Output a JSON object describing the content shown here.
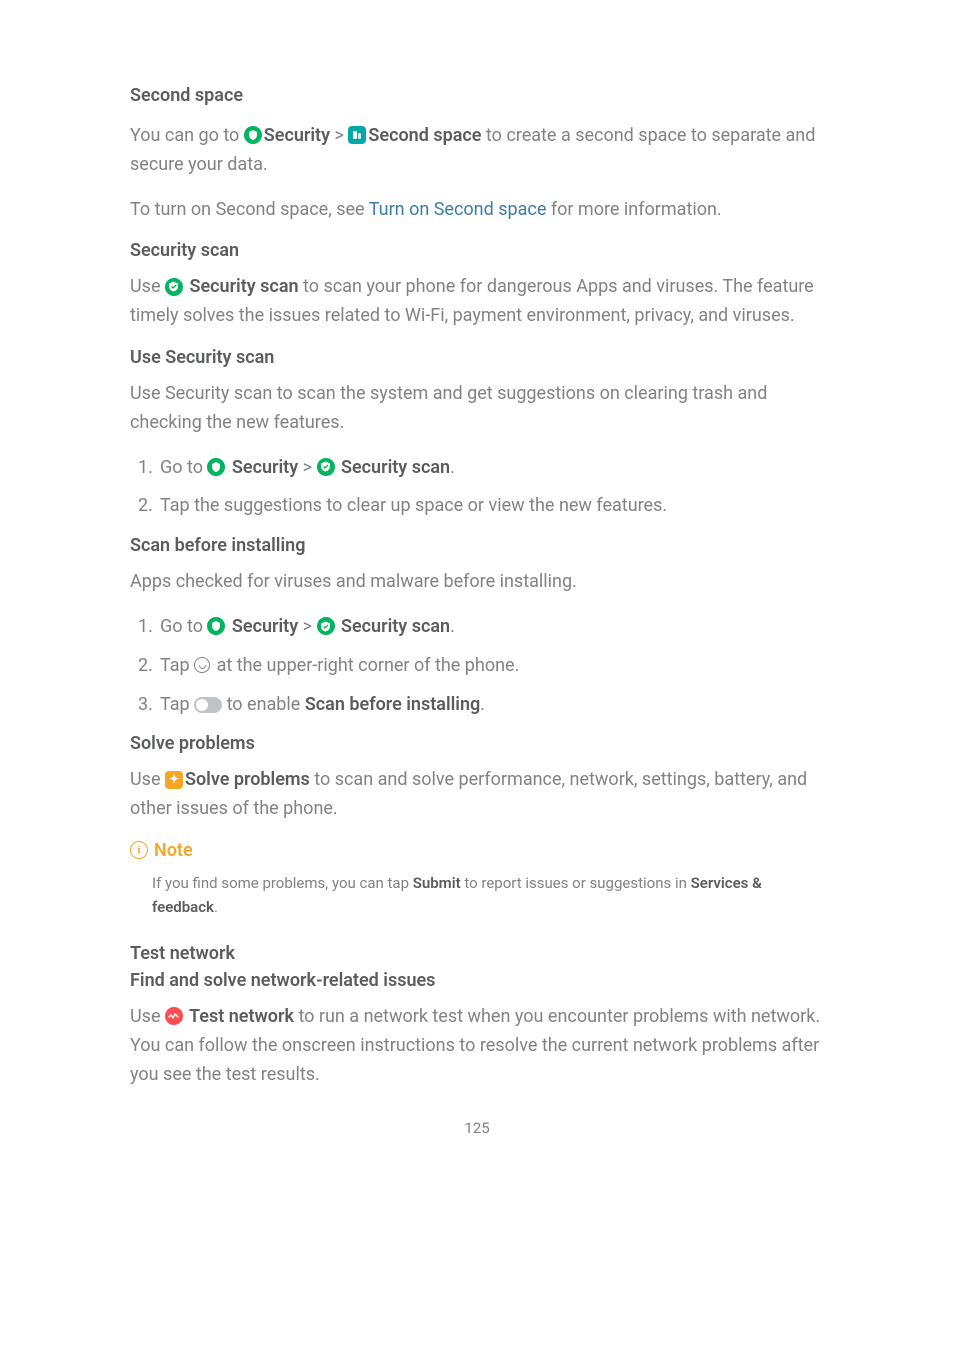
{
  "section1": {
    "heading": "Second space",
    "p1_a": "You can go to ",
    "p1_b": "Security",
    "p1_c": " > ",
    "p1_d": "Second space",
    "p1_e": " to create a second space to separate and secure your data.",
    "p2_a": "To turn on Second space, see ",
    "p2_link": "Turn on Second space",
    "p2_b": " for more information."
  },
  "section2": {
    "heading": "Security scan",
    "p1_a": "Use ",
    "p1_b": " Security scan",
    "p1_c": " to scan your phone for dangerous Apps and viruses. The feature timely solves the issues related to Wi-Fi, payment environment, privacy, and viruses."
  },
  "section3": {
    "heading": "Use Security scan",
    "p1": "Use Security scan to scan the system and get suggestions on clearing trash and checking the new features.",
    "li1_a": "Go to ",
    "li1_b": " Security",
    "li1_c": " > ",
    "li1_d": " Security scan",
    "li1_e": ".",
    "li2": "Tap the suggestions to clear up space or view the new features."
  },
  "section4": {
    "heading": "Scan before installing",
    "p1": "Apps checked for viruses and malware before installing.",
    "li1_a": "Go to ",
    "li1_b": " Security",
    "li1_c": " > ",
    "li1_d": " Security scan",
    "li1_e": ".",
    "li2_a": "Tap ",
    "li2_b": " at the upper-right corner of the phone.",
    "li3_a": "Tap ",
    "li3_b": " to enable ",
    "li3_c": "Scan before installing",
    "li3_d": "."
  },
  "section5": {
    "heading": "Solve problems",
    "p1_a": "Use ",
    "p1_b": "Solve problems",
    "p1_c": " to scan and solve performance, network, settings, battery, and other issues of the phone."
  },
  "note": {
    "label": "Note",
    "body_a": "If you find some problems, you can tap ",
    "body_b": "Submit",
    "body_c": " to report issues or suggestions in ",
    "body_d": "Services & feedback",
    "body_e": "."
  },
  "section6": {
    "heading1": "Test network",
    "heading2": "Find and solve network-related issues",
    "p1_a": "Use ",
    "p1_b": " Test network",
    "p1_c": " to run a network test when you encounter problems with network. You can follow the onscreen instructions to resolve the current network problems after you see the test results."
  },
  "page_number": "125"
}
